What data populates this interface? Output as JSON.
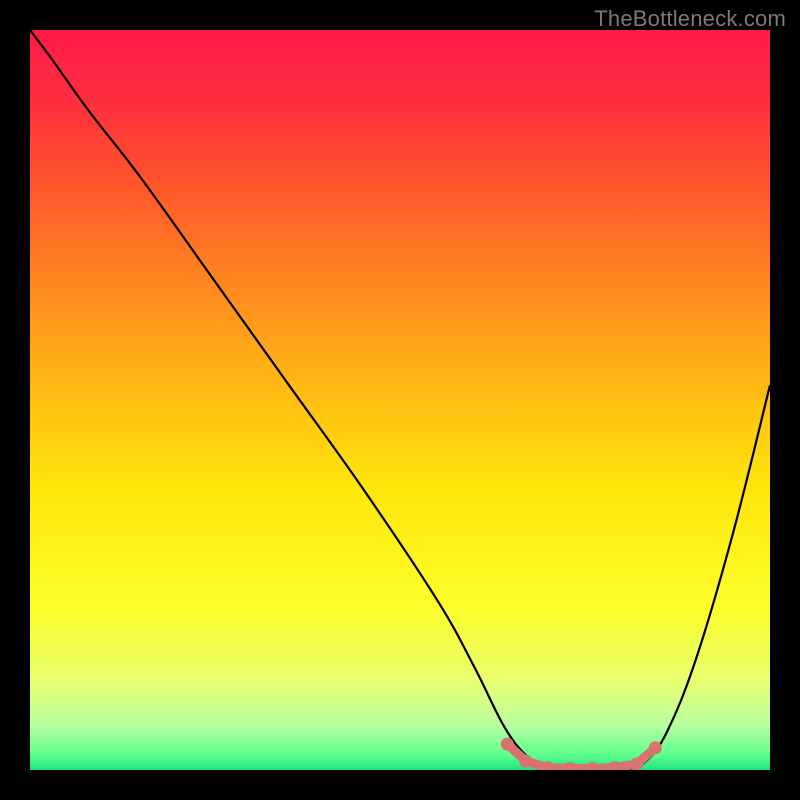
{
  "watermark": "TheBottleneck.com",
  "chart_data": {
    "type": "line",
    "title": "",
    "xlabel": "",
    "ylabel": "",
    "xlim": [
      0,
      100
    ],
    "ylim": [
      0,
      100
    ],
    "background_gradient": {
      "stops": [
        {
          "pos": 0.0,
          "color": "#ff1a4a"
        },
        {
          "pos": 0.1,
          "color": "#ff2f3e"
        },
        {
          "pos": 0.22,
          "color": "#ff5a2a"
        },
        {
          "pos": 0.35,
          "color": "#ff8a1f"
        },
        {
          "pos": 0.5,
          "color": "#ffbf12"
        },
        {
          "pos": 0.62,
          "color": "#ffe60a"
        },
        {
          "pos": 0.78,
          "color": "#fcff2a"
        },
        {
          "pos": 0.88,
          "color": "#e8ff70"
        },
        {
          "pos": 0.94,
          "color": "#b8ffa0"
        },
        {
          "pos": 0.98,
          "color": "#5cff8f"
        },
        {
          "pos": 1.0,
          "color": "#22e37a"
        }
      ]
    },
    "series": [
      {
        "name": "bottleneck-curve",
        "x": [
          0,
          3,
          8,
          15,
          25,
          35,
          45,
          55,
          60,
          64,
          67,
          70,
          75,
          80,
          83,
          86,
          90,
          95,
          100
        ],
        "y": [
          100,
          96,
          89,
          80,
          66,
          52,
          38,
          23,
          14,
          6,
          2,
          0,
          0,
          0,
          1,
          5,
          15,
          32,
          52
        ]
      }
    ],
    "highlight": {
      "name": "flat-bottom-markers",
      "color": "#d9716f",
      "points": [
        {
          "x": 64.5,
          "y": 3.5
        },
        {
          "x": 67,
          "y": 1.2
        },
        {
          "x": 70,
          "y": 0.3
        },
        {
          "x": 73,
          "y": 0.2
        },
        {
          "x": 76,
          "y": 0.2
        },
        {
          "x": 79,
          "y": 0.3
        },
        {
          "x": 82,
          "y": 0.8
        },
        {
          "x": 84.5,
          "y": 3.0
        }
      ]
    }
  }
}
